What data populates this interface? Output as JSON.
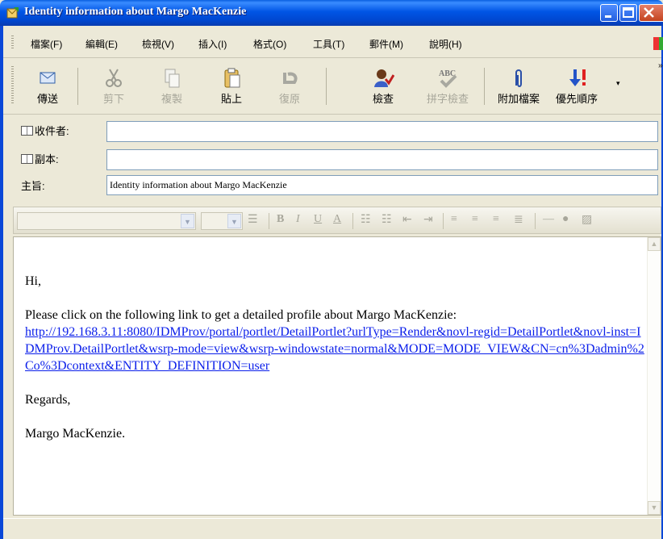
{
  "window": {
    "title": "Identity information about Margo MacKenzie"
  },
  "menu": {
    "items": [
      "檔案(F)",
      "編輯(E)",
      "檢視(V)",
      "插入(I)",
      "格式(O)",
      "工具(T)",
      "郵件(M)",
      "說明(H)"
    ]
  },
  "toolbar": {
    "send": "傳送",
    "cut": "剪下",
    "copy": "複製",
    "paste": "貼上",
    "undo": "復原",
    "check": "檢查",
    "spelling": "拼字檢查",
    "attach": "附加檔案",
    "priority": "優先順序",
    "more": "»"
  },
  "header": {
    "to_label": "收件者:",
    "to_value": "",
    "cc_label": "副本:",
    "cc_value": "",
    "subject_label": "主旨:",
    "subject_value": "Identity information about Margo MacKenzie"
  },
  "format_bar": {
    "font_name": "",
    "font_size": ""
  },
  "message": {
    "greeting": "Hi,",
    "intro": "Please click on the following link to get a detailed profile about Margo MacKenzie:",
    "link": "http://192.168.3.11:8080/IDMProv/portal/portlet/DetailPortlet?urlType=Render&novl-regid=DetailPortlet&novl-inst=IDMProv.DetailPortlet&wsrp-mode=view&wsrp-windowstate=normal&MODE=MODE_VIEW&CN=cn%3Dadmin%2Co%3Dcontext&ENTITY_DEFINITION=user",
    "closing": "Regards,",
    "signature": "Margo MacKenzie."
  },
  "colors": {
    "titlebar": "#0055E5",
    "link": "#0A1EEA",
    "chrome": "#ECE9D8"
  }
}
